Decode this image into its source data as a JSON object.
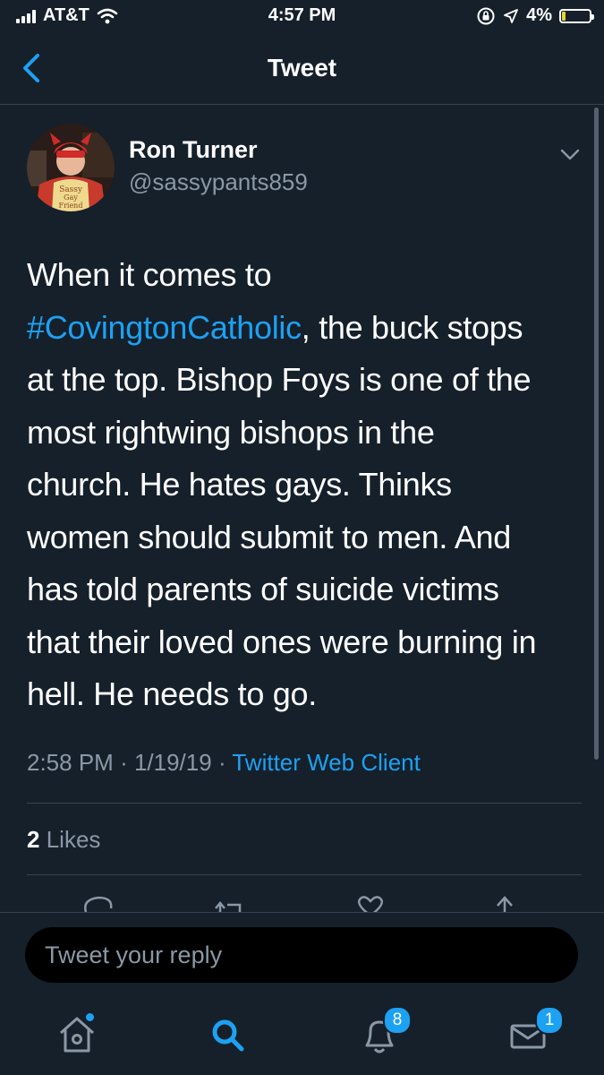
{
  "status_bar": {
    "carrier": "AT&T",
    "time": "4:57 PM",
    "battery": "4%",
    "battery_level": 0.04
  },
  "nav": {
    "title": "Tweet"
  },
  "tweet": {
    "author_name": "Ron Turner",
    "author_handle": "@sassypants859",
    "text_lines": [
      [
        "When it comes to"
      ],
      [
        {
          "hashtag": "#CovingtonCatholic"
        },
        ", the buck stops"
      ],
      [
        "at the top. Bishop Foys is one of the"
      ],
      [
        "most rightwing bishops in the"
      ],
      [
        "church. He hates gays. Thinks"
      ],
      [
        "women should submit to men. And"
      ],
      [
        "has told parents of suicide victims"
      ],
      [
        "that their loved ones were burning in"
      ],
      [
        "hell. He needs to go."
      ]
    ],
    "time": "2:58 PM",
    "date": "1/19/19",
    "client": "Twitter Web Client",
    "likes_count": "2",
    "likes_label": "Likes",
    "avatar_shirt_text": "Sassy Gay Friend"
  },
  "reply": {
    "placeholder": "Tweet your reply"
  },
  "tab_bar": {
    "tabs": [
      {
        "name": "home",
        "icon": "home-icon",
        "active": false,
        "dot": true
      },
      {
        "name": "search",
        "icon": "search-icon",
        "active": true
      },
      {
        "name": "notifications",
        "icon": "bell-icon",
        "badge": "8"
      },
      {
        "name": "messages",
        "icon": "envelope-icon",
        "badge": "1"
      }
    ]
  },
  "colors": {
    "background": "#15202b",
    "accent": "#1da1f2",
    "secondary_text": "#8b98a5",
    "divider": "#38444d"
  }
}
